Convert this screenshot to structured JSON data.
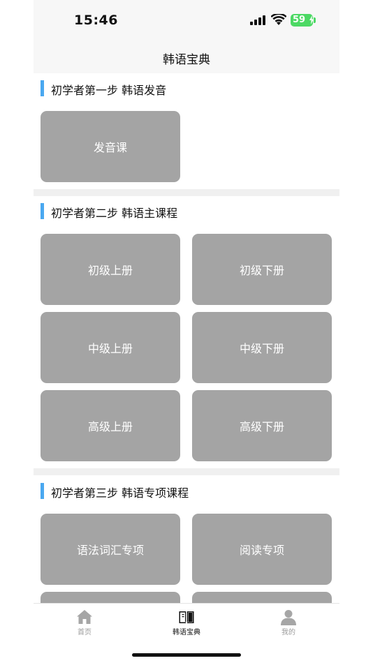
{
  "status_bar": {
    "time": "15:46",
    "battery": "59"
  },
  "nav": {
    "title": "韩语宝典"
  },
  "sections": [
    {
      "title": "初学者第一步 韩语发音",
      "tiles": [
        "发音课"
      ]
    },
    {
      "title": "初学者第二步 韩语主课程",
      "tiles": [
        "初级上册",
        "初级下册",
        "中级上册",
        "中级下册",
        "高级上册",
        "高级下册"
      ]
    },
    {
      "title": "初学者第三步 韩语专项课程",
      "tiles": [
        "语法词汇专项",
        "阅读专项",
        "",
        ""
      ]
    }
  ],
  "tab_bar": {
    "items": [
      {
        "label": "首页",
        "icon": "home-icon",
        "active": false
      },
      {
        "label": "韩语宝典",
        "icon": "book-icon",
        "active": true
      },
      {
        "label": "我的",
        "icon": "profile-icon",
        "active": false
      }
    ]
  },
  "colors": {
    "accent": "#4aa8f0",
    "tile": "#a4a4a4",
    "battery": "#4cd964"
  }
}
